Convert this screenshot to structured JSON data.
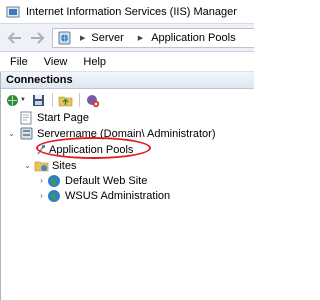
{
  "window": {
    "title": "Internet Information Services (IIS) Manager",
    "app_icon": "iis-app-icon"
  },
  "address_bar": {
    "back_icon": "back-arrow-icon",
    "forward_icon": "forward-arrow-icon",
    "breadcrumbs": [
      "Server",
      "Application Pools"
    ]
  },
  "menu": {
    "items": [
      "File",
      "View",
      "Help"
    ]
  },
  "connections": {
    "header": "Connections",
    "toolbar": [
      "connect-icon",
      "save-icon",
      "up-folder-icon",
      "disconnect-icon"
    ],
    "tree": {
      "start_page": "Start Page",
      "server": "Servername (Domain\\   Administrator)",
      "application_pools": "Application Pools",
      "sites": "Sites",
      "site_items": [
        "Default Web Site",
        "WSUS Administration"
      ]
    }
  },
  "colors": {
    "annotation_ellipse": "#e01b24",
    "panel_header_bg": "#dfe7f1"
  }
}
